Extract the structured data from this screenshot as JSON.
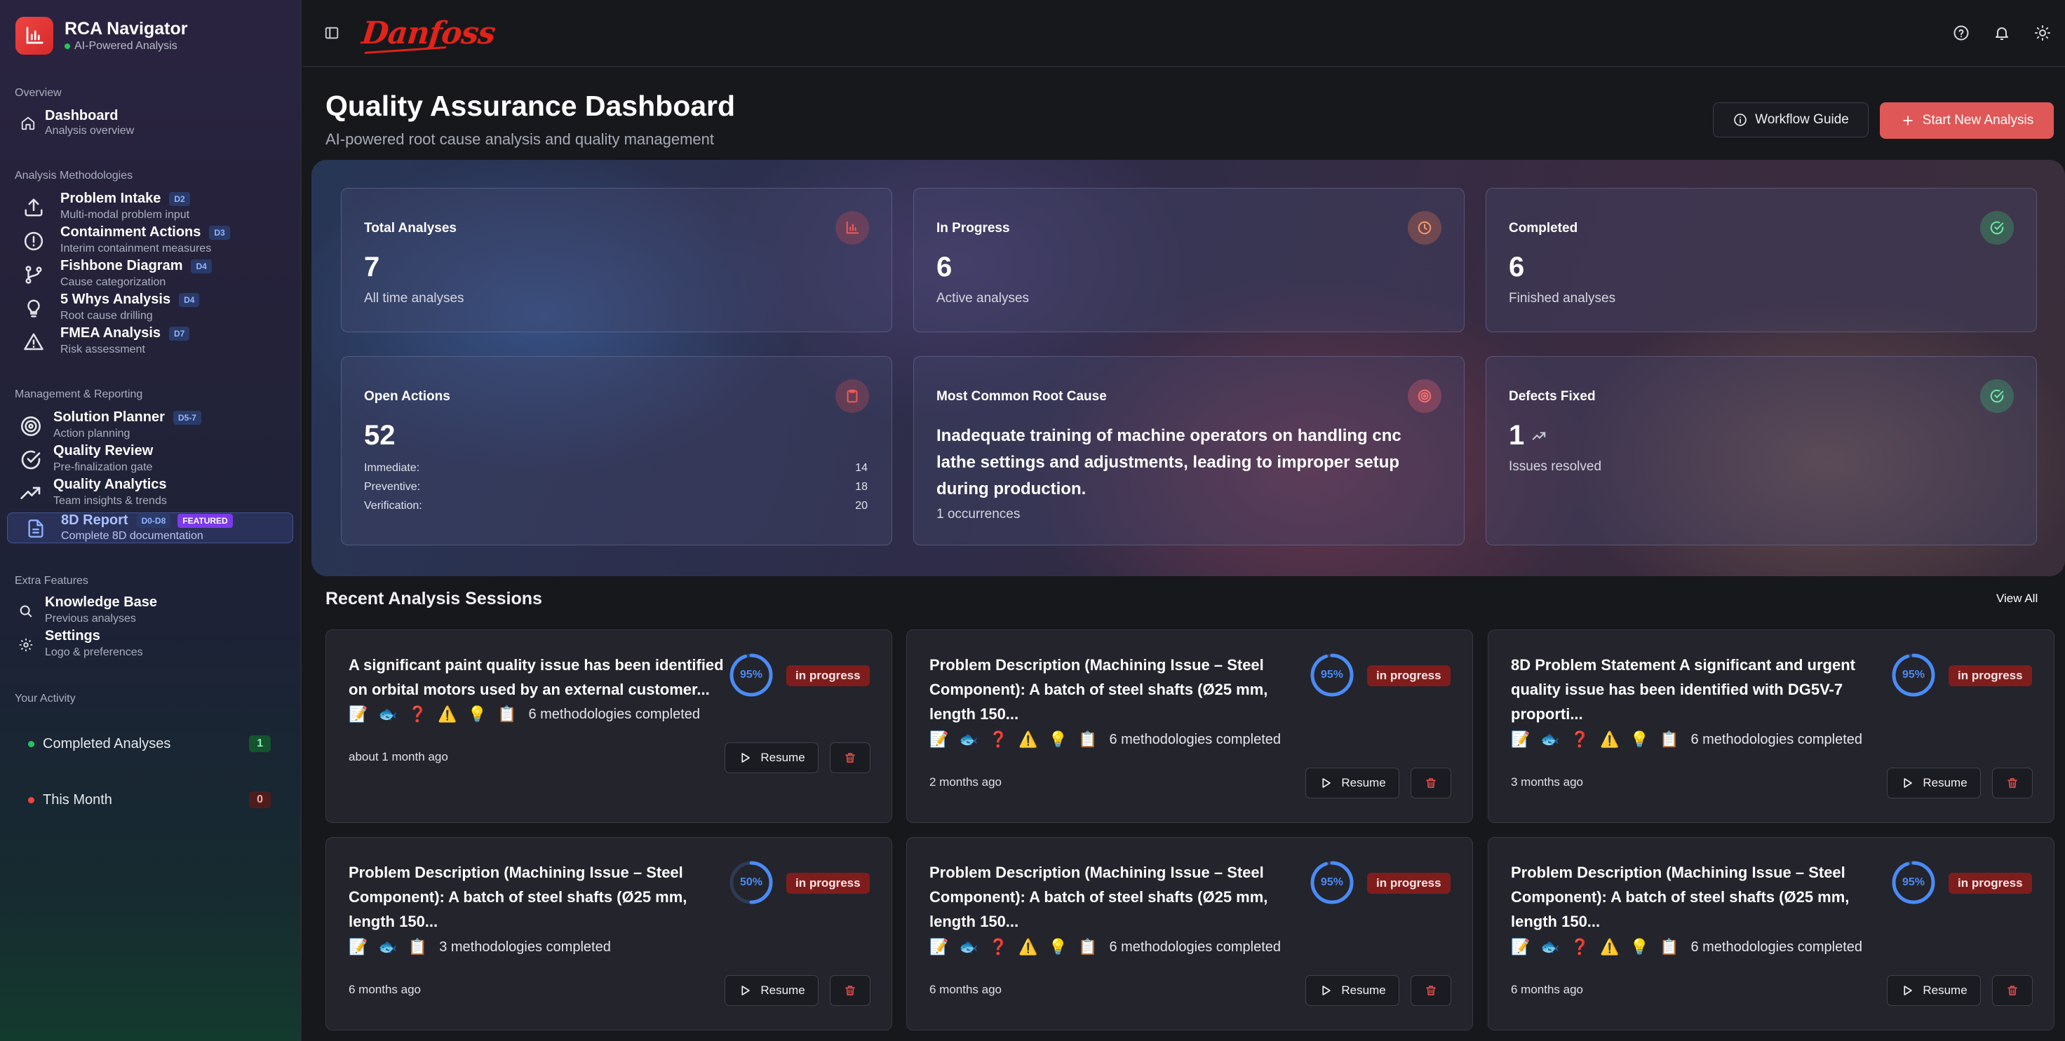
{
  "brand": {
    "name": "RCA Navigator",
    "subtitle": "AI-Powered Analysis",
    "logo_text": "Danfoss"
  },
  "colors": {
    "accent": "#e05757",
    "status_active": "#22c55e",
    "progress": "#4a8bf5",
    "badge_bg": "#7f1d1d"
  },
  "sidebar": {
    "overview": {
      "title": "Overview",
      "items": [
        {
          "label": "Dashboard",
          "sub": "Analysis overview",
          "icon": "home-icon"
        }
      ]
    },
    "methodologies": {
      "title": "Analysis Methodologies",
      "items": [
        {
          "label": "Problem Intake",
          "badge": "D2",
          "sub": "Multi-modal problem input",
          "icon": "upload-icon"
        },
        {
          "label": "Containment Actions",
          "badge": "D3",
          "sub": "Interim containment measures",
          "icon": "alert-circle-icon"
        },
        {
          "label": "Fishbone Diagram",
          "badge": "D4",
          "sub": "Cause categorization",
          "icon": "git-branch-icon"
        },
        {
          "label": "5 Whys Analysis",
          "badge": "D4",
          "sub": "Root cause drilling",
          "icon": "lightbulb-icon"
        },
        {
          "label": "FMEA Analysis",
          "badge": "D7",
          "sub": "Risk assessment",
          "icon": "warning-icon"
        }
      ]
    },
    "management": {
      "title": "Management & Reporting",
      "items": [
        {
          "label": "Solution Planner",
          "badge": "D5-7",
          "sub": "Action planning",
          "icon": "target-icon"
        },
        {
          "label": "Quality Review",
          "sub": "Pre-finalization gate",
          "icon": "check-circle-icon"
        },
        {
          "label": "Quality Analytics",
          "sub": "Team insights & trends",
          "icon": "trending-up-icon"
        },
        {
          "label": "8D Report",
          "badge": "D0-D8",
          "featured": "FEATURED",
          "sub": "Complete 8D documentation",
          "icon": "document-icon"
        }
      ]
    },
    "extra": {
      "title": "Extra Features",
      "items": [
        {
          "label": "Knowledge Base",
          "sub": "Previous analyses",
          "icon": "search-icon"
        },
        {
          "label": "Settings",
          "sub": "Logo & preferences",
          "icon": "gear-icon"
        }
      ]
    },
    "activity": {
      "title": "Your Activity",
      "items": [
        {
          "label": "Completed Analyses",
          "count": "1"
        },
        {
          "label": "This Month",
          "count": "0"
        }
      ]
    }
  },
  "header": {
    "title": "Quality Assurance Dashboard",
    "subtitle": "AI-powered root cause analysis and quality management",
    "guide_button": "Workflow Guide",
    "new_button": "Start New Analysis"
  },
  "stats": {
    "total": {
      "label": "Total Analyses",
      "value": "7",
      "sub": "All time analyses",
      "icon": "bar-chart-icon"
    },
    "in_progress": {
      "label": "In Progress",
      "value": "6",
      "sub": "Active analyses",
      "icon": "clock-icon"
    },
    "completed": {
      "label": "Completed",
      "value": "6",
      "sub": "Finished analyses",
      "icon": "check-circle-icon"
    },
    "open_actions": {
      "label": "Open Actions",
      "value": "52",
      "icon": "clipboard-icon",
      "breakdown": [
        {
          "label": "Immediate:",
          "value": "14"
        },
        {
          "label": "Preventive:",
          "value": "18"
        },
        {
          "label": "Verification:",
          "value": "20"
        }
      ]
    },
    "root_cause": {
      "label": "Most Common Root Cause",
      "text": "Inadequate training of machine operators on handling cnc lathe settings and adjustments, leading to improper setup during production.",
      "occurrences": "1 occurrences",
      "icon": "target-icon"
    },
    "defects": {
      "label": "Defects Fixed",
      "value": "1",
      "sub": "Issues resolved",
      "icon": "check-circle-icon"
    }
  },
  "recent": {
    "title": "Recent Analysis Sessions",
    "view_all": "View All",
    "resume_label": "Resume",
    "sessions": [
      {
        "title": "A significant paint quality issue has been identified on orbital motors used by an external customer...",
        "progress": 95,
        "progress_label": "95%",
        "status": "in progress",
        "method_icons": [
          "📝",
          "🐟",
          "❓",
          "⚠️",
          "💡",
          "📋"
        ],
        "methods_text": "6 methodologies completed",
        "time": "about 1 month ago"
      },
      {
        "title": "Problem Description (Machining Issue – Steel Component): A batch of steel shafts (Ø25 mm, length 150...",
        "progress": 95,
        "progress_label": "95%",
        "status": "in progress",
        "method_icons": [
          "📝",
          "🐟",
          "❓",
          "⚠️",
          "💡",
          "📋"
        ],
        "methods_text": "6 methodologies completed",
        "time": "2 months ago"
      },
      {
        "title": "8D Problem Statement A significant and urgent quality issue has been identified with DG5V-7 proporti...",
        "progress": 95,
        "progress_label": "95%",
        "status": "in progress",
        "method_icons": [
          "📝",
          "🐟",
          "❓",
          "⚠️",
          "💡",
          "📋"
        ],
        "methods_text": "6 methodologies completed",
        "time": "3 months ago"
      },
      {
        "title": "Problem Description (Machining Issue – Steel Component): A batch of steel shafts (Ø25 mm, length 150...",
        "progress": 50,
        "progress_label": "50%",
        "status": "in progress",
        "method_icons": [
          "📝",
          "🐟",
          "📋"
        ],
        "methods_text": "3 methodologies completed",
        "time": "6 months ago"
      },
      {
        "title": "Problem Description (Machining Issue – Steel Component): A batch of steel shafts (Ø25 mm, length 150...",
        "progress": 95,
        "progress_label": "95%",
        "status": "in progress",
        "method_icons": [
          "📝",
          "🐟",
          "❓",
          "⚠️",
          "💡",
          "📋"
        ],
        "methods_text": "6 methodologies completed",
        "time": "6 months ago"
      },
      {
        "title": "Problem Description (Machining Issue – Steel Component): A batch of steel shafts (Ø25 mm, length 150...",
        "progress": 95,
        "progress_label": "95%",
        "status": "in progress",
        "method_icons": [
          "📝",
          "🐟",
          "❓",
          "⚠️",
          "💡",
          "📋"
        ],
        "methods_text": "6 methodologies completed",
        "time": "6 months ago"
      }
    ]
  }
}
